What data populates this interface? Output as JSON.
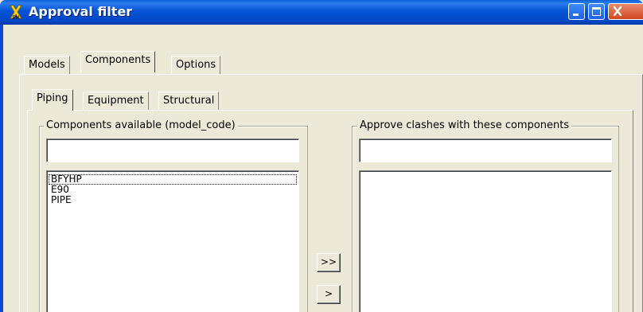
{
  "window": {
    "title": "Approval filter",
    "icon": "tekla-app-icon",
    "controls": [
      "minimize",
      "maximize",
      "close"
    ]
  },
  "main_tabs": [
    {
      "label": "Models",
      "active": false
    },
    {
      "label": "Components",
      "active": true
    },
    {
      "label": "Options",
      "active": false
    }
  ],
  "sub_tabs": [
    {
      "label": "Piping",
      "active": true
    },
    {
      "label": "Equipment",
      "active": false
    },
    {
      "label": "Structural",
      "active": false
    }
  ],
  "available": {
    "group_label": "Components available (model_code)",
    "filter_value": "",
    "items": [
      "BFYHP",
      "E90",
      "PIPE"
    ],
    "focused_index": 0
  },
  "approved": {
    "group_label": "Approve clashes with these components",
    "filter_value": "",
    "items": []
  },
  "buttons": {
    "add_all": ">>",
    "add_one": ">"
  }
}
